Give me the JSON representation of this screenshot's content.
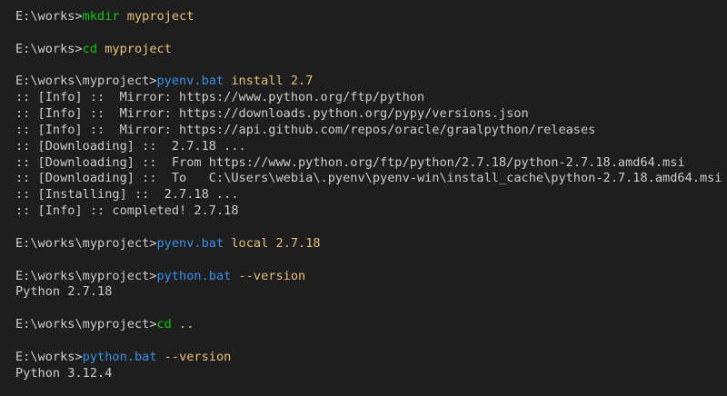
{
  "colors": {
    "background": "#1e1e1e",
    "text": "#cccccc",
    "command_builtin": "#16c60c",
    "command_bat": "#3b8eea",
    "argument": "#e5c07b"
  },
  "terminal": {
    "lines": [
      {
        "type": "cmd",
        "prompt": "E:\\works>",
        "command": "mkdir",
        "command_style": "green",
        "args": " myproject"
      },
      {
        "type": "blank"
      },
      {
        "type": "cmd",
        "prompt": "E:\\works>",
        "command": "cd",
        "command_style": "green",
        "args": " myproject"
      },
      {
        "type": "blank"
      },
      {
        "type": "cmd",
        "prompt": "E:\\works\\myproject>",
        "command": "pyenv.bat",
        "command_style": "blue",
        "args": " install 2.7"
      },
      {
        "type": "out",
        "text": ":: [Info] ::  Mirror: https://www.python.org/ftp/python"
      },
      {
        "type": "out",
        "text": ":: [Info] ::  Mirror: https://downloads.python.org/pypy/versions.json"
      },
      {
        "type": "out",
        "text": ":: [Info] ::  Mirror: https://api.github.com/repos/oracle/graalpython/releases"
      },
      {
        "type": "out",
        "text": ":: [Downloading] ::  2.7.18 ..."
      },
      {
        "type": "out",
        "text": ":: [Downloading] ::  From https://www.python.org/ftp/python/2.7.18/python-2.7.18.amd64.msi"
      },
      {
        "type": "out",
        "text": ":: [Downloading] ::  To   C:\\Users\\webia\\.pyenv\\pyenv-win\\install_cache\\python-2.7.18.amd64.msi"
      },
      {
        "type": "out",
        "text": ":: [Installing] ::  2.7.18 ..."
      },
      {
        "type": "out",
        "text": ":: [Info] :: completed! 2.7.18"
      },
      {
        "type": "blank"
      },
      {
        "type": "cmd",
        "prompt": "E:\\works\\myproject>",
        "command": "pyenv.bat",
        "command_style": "blue",
        "args": " local 2.7.18"
      },
      {
        "type": "blank"
      },
      {
        "type": "cmd",
        "prompt": "E:\\works\\myproject>",
        "command": "python.bat",
        "command_style": "blue",
        "args": " --version"
      },
      {
        "type": "out",
        "text": "Python 2.7.18"
      },
      {
        "type": "blank"
      },
      {
        "type": "cmd",
        "prompt": "E:\\works\\myproject>",
        "command": "cd",
        "command_style": "green",
        "args": " .."
      },
      {
        "type": "blank"
      },
      {
        "type": "cmd",
        "prompt": "E:\\works>",
        "command": "python.bat",
        "command_style": "blue",
        "args": " --version"
      },
      {
        "type": "out",
        "text": "Python 3.12.4"
      }
    ]
  }
}
